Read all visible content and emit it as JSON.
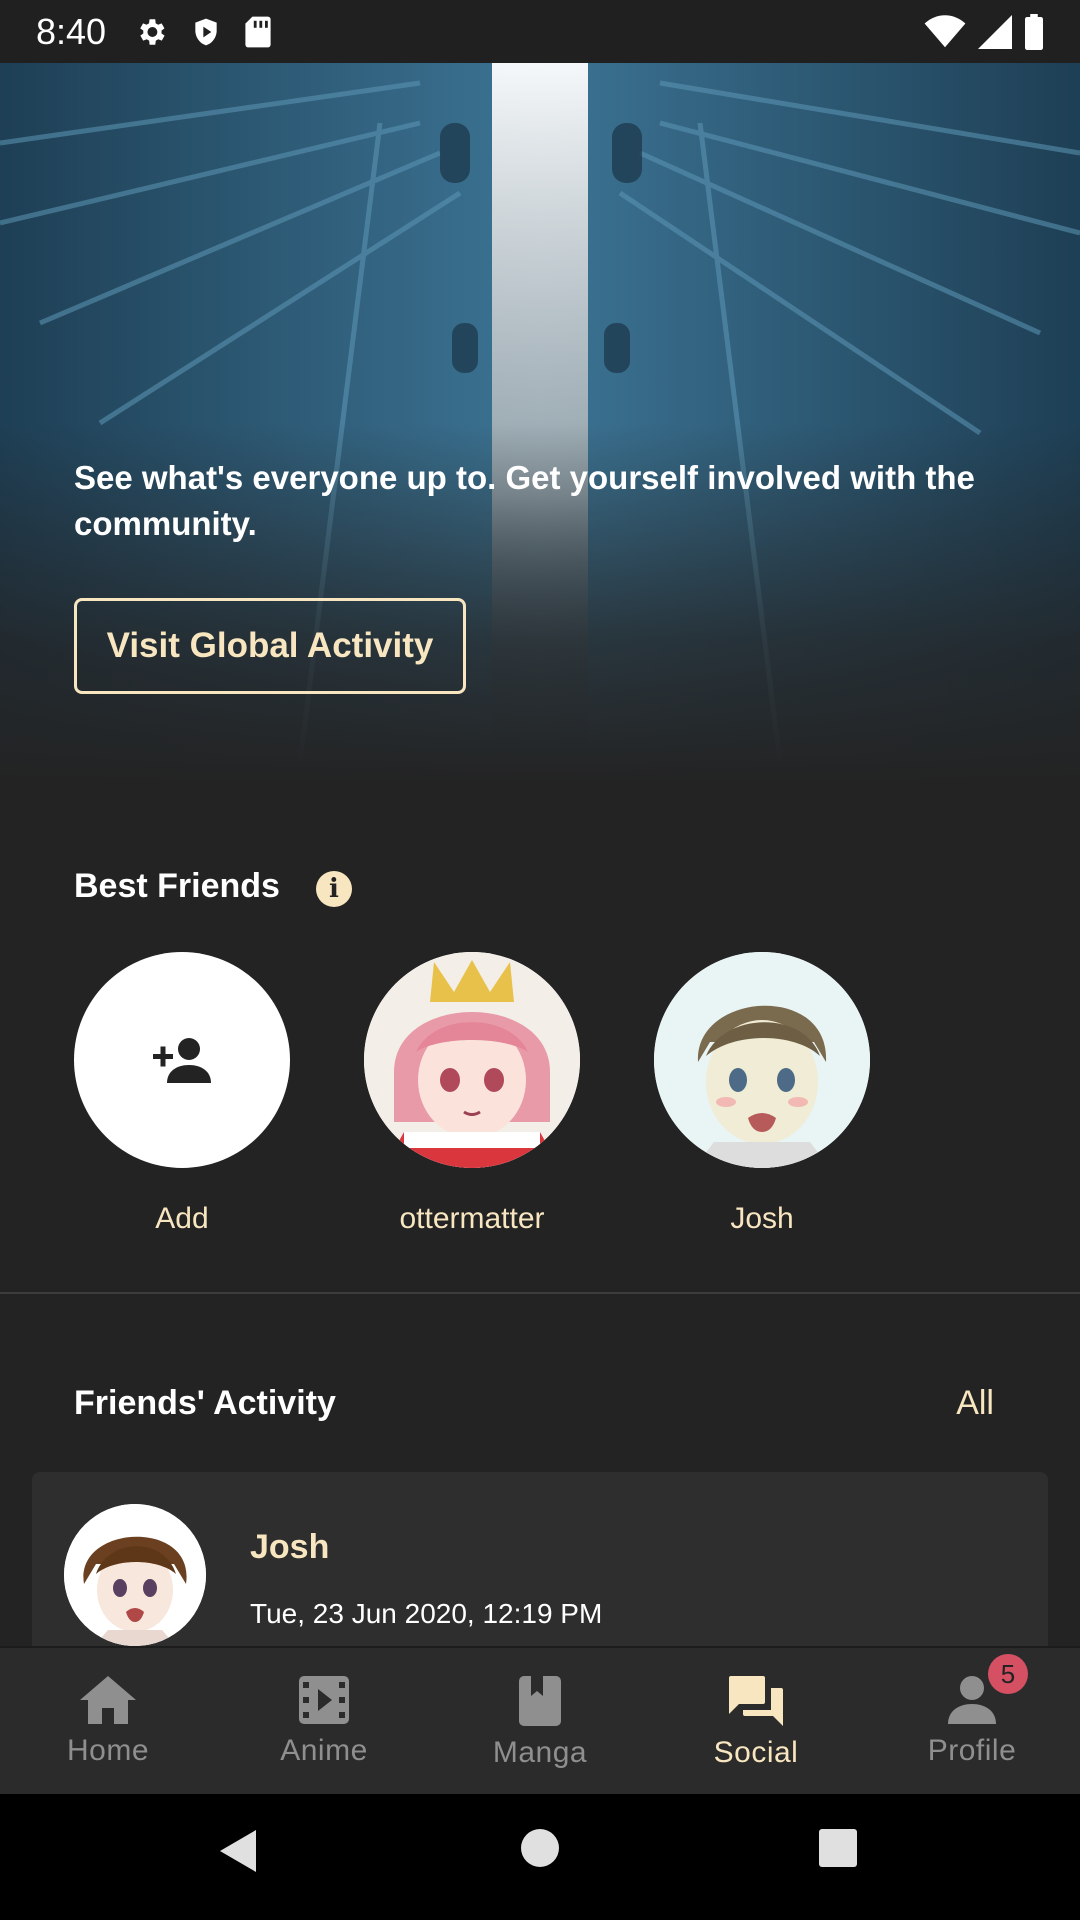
{
  "status_bar": {
    "time": "8:40",
    "left_icons": [
      "settings-icon",
      "shield-icon",
      "sd-card-icon"
    ],
    "right_icons": [
      "wifi-icon",
      "cellular-icon",
      "battery-icon"
    ]
  },
  "hero": {
    "description": "See what's everyone up to. Get yourself involved with the community.",
    "button_label": "Visit Global Activity"
  },
  "best_friends": {
    "title": "Best Friends",
    "info_icon": "info-icon",
    "items": [
      {
        "name": "Add",
        "icon": "add-person-icon"
      },
      {
        "name": "ottermatter"
      },
      {
        "name": "Josh"
      }
    ]
  },
  "friends_activity": {
    "title": "Friends' Activity",
    "all_label": "All",
    "items": [
      {
        "name": "Josh",
        "date": "Tue, 23 Jun 2020, 12:19 PM"
      }
    ]
  },
  "bottom_nav": {
    "items": [
      {
        "label": "Home",
        "icon": "home-icon"
      },
      {
        "label": "Anime",
        "icon": "film-icon"
      },
      {
        "label": "Manga",
        "icon": "book-icon"
      },
      {
        "label": "Social",
        "icon": "chat-icon",
        "active": true
      },
      {
        "label": "Profile",
        "icon": "person-icon",
        "badge": "5"
      }
    ]
  },
  "system_nav": [
    "back-icon",
    "home-circle-icon",
    "recents-icon"
  ],
  "colors": {
    "accent": "#f7e6c0",
    "background": "#232323",
    "card": "#2e2e2e",
    "badge": "#d65063"
  }
}
